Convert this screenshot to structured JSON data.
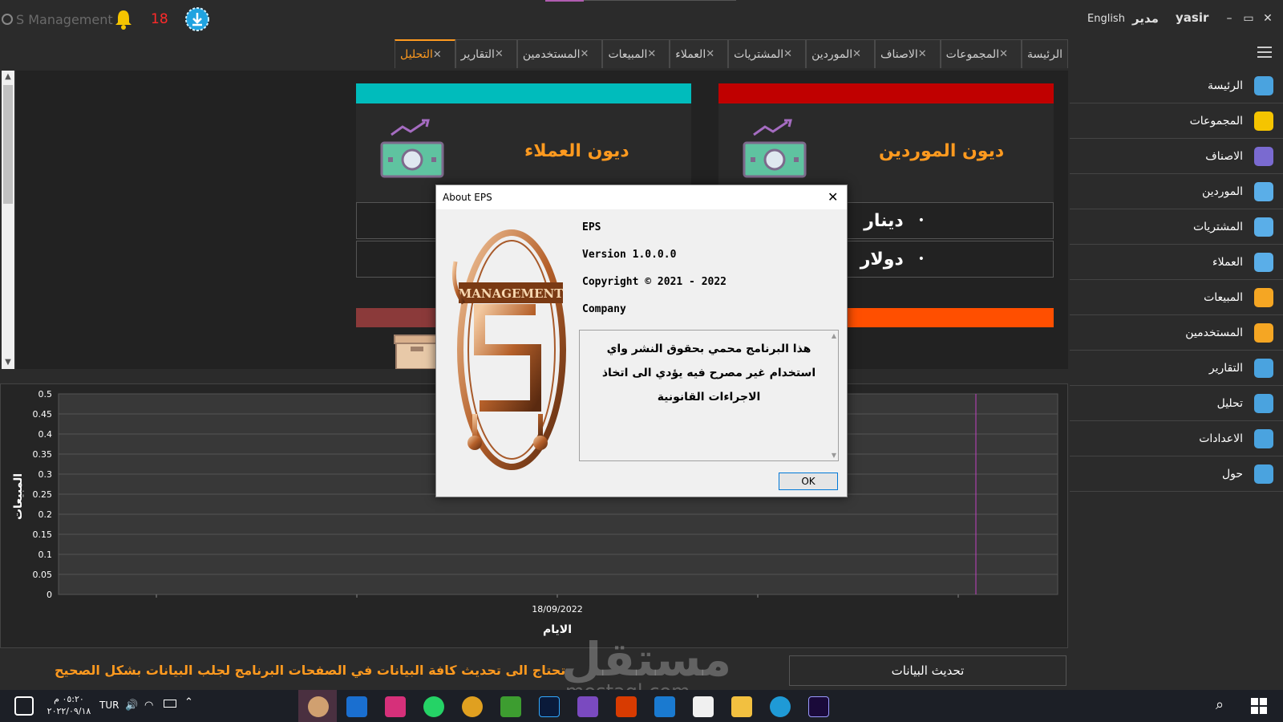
{
  "titlebar": {
    "app_title": "S Management",
    "notification_count": "18",
    "language": "English",
    "role": "مدير",
    "username": "yasir",
    "minimize": "–",
    "maximize": "▭",
    "close": "✕"
  },
  "tabs": [
    {
      "label": "الرئيسة",
      "closable": false
    },
    {
      "label": "المجموعات",
      "closable": true
    },
    {
      "label": "الاصناف",
      "closable": true
    },
    {
      "label": "الموردين",
      "closable": true
    },
    {
      "label": "المشتريات",
      "closable": true
    },
    {
      "label": "العملاء",
      "closable": true
    },
    {
      "label": "المبيعات",
      "closable": true
    },
    {
      "label": "المستخدمين",
      "closable": true
    },
    {
      "label": "التقارير",
      "closable": true
    },
    {
      "label": "التحليل",
      "closable": true,
      "active": true
    }
  ],
  "sidebar": {
    "items": [
      {
        "label": "الرئيسة",
        "icon": "home-icon"
      },
      {
        "label": "المجموعات",
        "icon": "groups-icon"
      },
      {
        "label": "الاصناف",
        "icon": "categories-icon"
      },
      {
        "label": "الموردين",
        "icon": "suppliers-icon"
      },
      {
        "label": "المشتريات",
        "icon": "cart-icon"
      },
      {
        "label": "العملاء",
        "icon": "customers-icon"
      },
      {
        "label": "المبيعات",
        "icon": "sales-icon"
      },
      {
        "label": "المستخدمين",
        "icon": "users-icon"
      },
      {
        "label": "التقارير",
        "icon": "reports-icon"
      },
      {
        "label": "تحليل",
        "icon": "analysis-icon"
      },
      {
        "label": "الاعدادات",
        "icon": "gear-icon"
      },
      {
        "label": "حول",
        "icon": "help-icon"
      }
    ]
  },
  "cards": {
    "suppliers_debt": {
      "title": "ديون الموردين",
      "color": "#c00000",
      "rows": [
        "دينار",
        "دولار"
      ]
    },
    "customers_debt": {
      "title": "ديون العملاء",
      "color": "#00bcbc"
    },
    "lower_left_color": "#8b3a3a",
    "lower_right_color": "#ff4f00"
  },
  "chart_data": {
    "type": "line",
    "ylabel": "المبيعات",
    "xlabel": "الايام",
    "ylim": [
      0,
      0.5
    ],
    "yticks": [
      "0",
      "0.05",
      "0.1",
      "0.15",
      "0.2",
      "0.25",
      "0.3",
      "0.35",
      "0.4",
      "0.45",
      "0.5"
    ],
    "categories": [
      "18/09/2022"
    ],
    "series": []
  },
  "bottom": {
    "refresh_label": "تحديث البيانات",
    "hint": "تحتاج الى تحديث كافة البيانات في الصفحات البرنامج لجلب البيانات بشكل الصحيح"
  },
  "dialog": {
    "title": "About EPS",
    "product": "EPS",
    "version": "Version 1.0.0.0",
    "copyright": "Copyright © 2021 - 2022",
    "company": "Company",
    "description": "هذا البرنامج محمي بحقوق النشر واي استخدام غير مصرح فيه يؤدي الى اتخاذ الاجراءات القانونية",
    "ok_label": "OK",
    "logo_text": "MANAGEMENT"
  },
  "taskbar": {
    "time": "٠٥:٢٠ م",
    "date": "٢٠٢٢/٠٩/١٨",
    "lang": "TUR"
  },
  "watermark": {
    "text": "مستقل",
    "sub": "mostaql.com"
  }
}
